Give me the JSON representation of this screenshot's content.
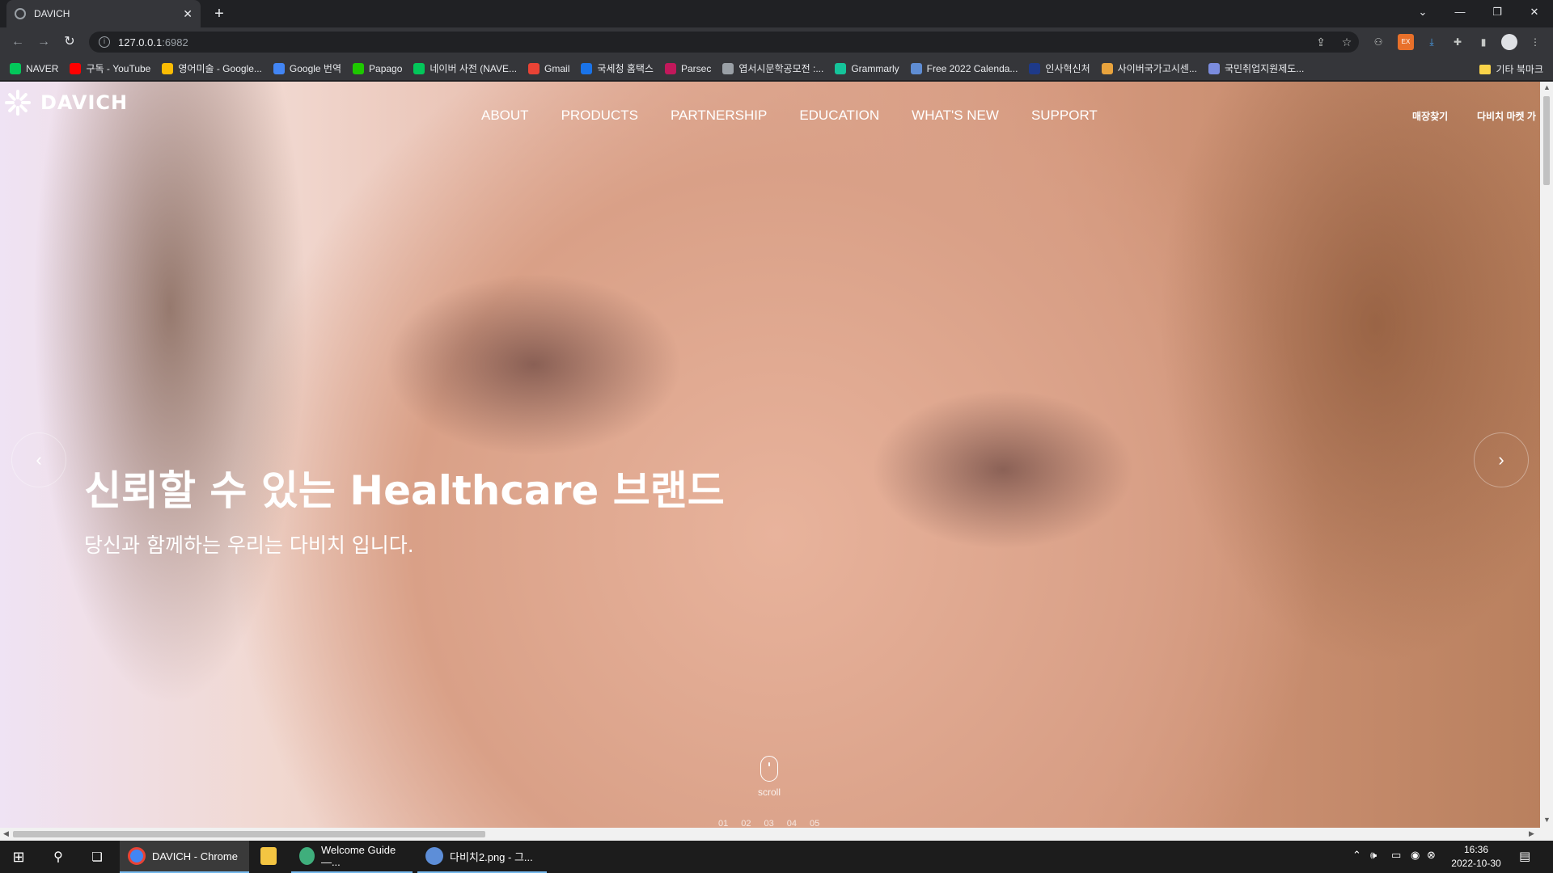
{
  "browser": {
    "tab_title": "DAVICH",
    "tab_close": "✕",
    "new_tab": "+",
    "url_host": "127.0.0.1",
    "url_port": ":6982",
    "window_controls": [
      "⌄",
      "—",
      "❐",
      "✕"
    ]
  },
  "bookmarks": [
    {
      "label": "NAVER",
      "color": "#03c75a"
    },
    {
      "label": "구독 - YouTube",
      "color": "#ff0000"
    },
    {
      "label": "영어미술 - Google...",
      "color": "#fbbc04"
    },
    {
      "label": "Google 번역",
      "color": "#4285f4"
    },
    {
      "label": "Papago",
      "color": "#1ec800"
    },
    {
      "label": "네이버 사전 (NAVE...",
      "color": "#03c75a"
    },
    {
      "label": "Gmail",
      "color": "#ea4335"
    },
    {
      "label": "국세청 홈택스",
      "color": "#1a73e8"
    },
    {
      "label": "Parsec",
      "color": "#c2185b"
    },
    {
      "label": "엽서시문학공모전 :...",
      "color": "#9aa0a6"
    },
    {
      "label": "Grammarly",
      "color": "#15c39a"
    },
    {
      "label": "Free 2022 Calenda...",
      "color": "#5f8dd3"
    },
    {
      "label": "인사혁신처",
      "color": "#1e3a8a"
    },
    {
      "label": "사이버국가고시센...",
      "color": "#e8a33d"
    },
    {
      "label": "국민취업지원제도...",
      "color": "#7b8cde"
    }
  ],
  "bookmarks_other": "기타 북마크",
  "site": {
    "logo_text": "DAVICH",
    "nav": [
      "ABOUT",
      "PRODUCTS",
      "PARTNERSHIP",
      "EDUCATION",
      "WHAT'S NEW",
      "SUPPORT"
    ],
    "util_store": "매장찾기",
    "util_market": "다비치 마켓 가",
    "hero_title": "신뢰할 수 있는 Healthcare 브랜드",
    "hero_sub": "당신과 함께하는 우리는 다비치 입니다.",
    "prev_arrow": "‹",
    "next_arrow": "›",
    "scroll_label": "scroll",
    "pager": [
      "01",
      "02",
      "03",
      "04",
      "05"
    ]
  },
  "taskbar": {
    "apps": [
      {
        "label": "DAVICH - Chrome",
        "color": "#4285f4"
      },
      {
        "label": "",
        "color": "#f4c542"
      },
      {
        "label": "Welcome Guide —...",
        "color": "#3fae7c"
      },
      {
        "label": "다비치2.png - 그...",
        "color": "#5d8ed8"
      }
    ],
    "tray_chevron": "⌃",
    "time": "16:36",
    "date": "2022-10-30"
  }
}
